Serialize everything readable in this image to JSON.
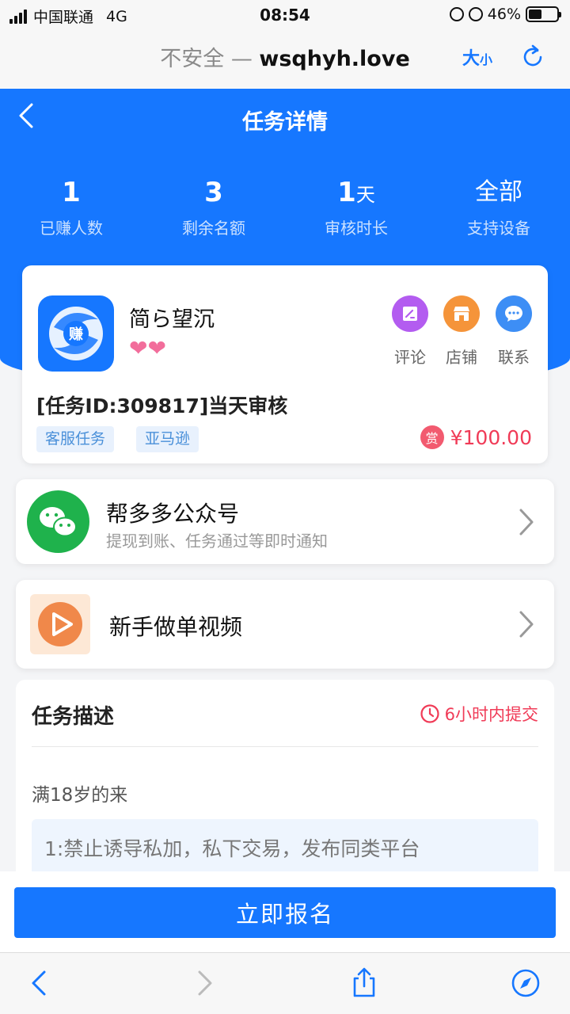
{
  "status_bar": {
    "carrier": "中国联通",
    "network": "4G",
    "time": "08:54",
    "battery": "46%",
    "battery_level": 0.46
  },
  "browser": {
    "insecure_label": "不安全",
    "separator": "—",
    "domain": "wsqhyh.love",
    "text_size_big": "大",
    "text_size_small": "小"
  },
  "header": {
    "title": "任务详情"
  },
  "stats": [
    {
      "value": "1",
      "unit": "",
      "label": "已赚人数"
    },
    {
      "value": "3",
      "unit": "",
      "label": "剩余名额"
    },
    {
      "value": "1",
      "unit": "天",
      "label": "审核时长"
    },
    {
      "value": "全部",
      "unit": "",
      "label": "支持设备"
    }
  ],
  "task": {
    "logo_text": "赚",
    "app_name": "简ら望沉",
    "hearts": "❤❤",
    "actions": [
      {
        "label": "评论",
        "color": "#b35cf0",
        "icon": "edit-icon"
      },
      {
        "label": "店铺",
        "color": "#f5943a",
        "icon": "shop-icon"
      },
      {
        "label": "联系",
        "color": "#3d8ef5",
        "icon": "chat-icon"
      }
    ],
    "id_title": "[任务ID:309817]当天审核",
    "tags": [
      "客服任务",
      "亚马逊"
    ],
    "reward_badge": "赏",
    "reward_amount": "¥100.00"
  },
  "wechat": {
    "title": "帮多多公众号",
    "subtitle": "提现到账、任务通过等即时通知"
  },
  "video": {
    "title": "新手做单视频"
  },
  "description": {
    "title": "任务描述",
    "deadline": "6小时内提交",
    "text": "满18岁的来",
    "rule": "1:禁止诱导私加，私下交易，发布同类平台"
  },
  "cta": {
    "label": "立即报名"
  },
  "colors": {
    "primary": "#1677ff",
    "accent_red": "#f03b57",
    "wechat_green": "#1fb24c"
  }
}
